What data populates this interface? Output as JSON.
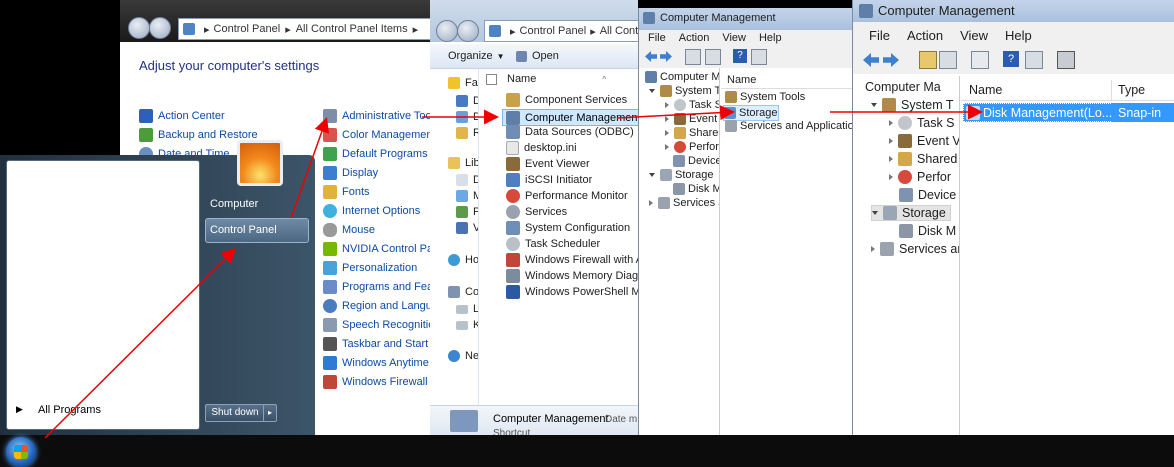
{
  "control_panel": {
    "breadcrumb": [
      "Control Panel",
      "All Control Panel Items"
    ],
    "heading": "Adjust your computer's settings",
    "left_items": [
      "Action Center",
      "Backup and Restore",
      "Date and Time"
    ],
    "items": [
      "Administrative Tools",
      "Color Management",
      "Default Programs",
      "Display",
      "Fonts",
      "Internet Options",
      "Mouse",
      "NVIDIA Control Panel",
      "Personalization",
      "Programs and Features",
      "Region and Language",
      "Speech Recognition",
      "Taskbar and Start Menu",
      "Windows Anytime Upgrade",
      "Windows Firewall"
    ]
  },
  "start_menu": {
    "right_items": [
      "Computer",
      "Control Panel"
    ],
    "all_programs": "All Programs",
    "shut_down": "Shut down"
  },
  "admin_tools": {
    "breadcrumb": [
      "Control Panel",
      "All Control Panel Items"
    ],
    "toolbar": {
      "organize": "Organize",
      "open": "Open"
    },
    "nav_items": [
      "Fav",
      "D",
      "D",
      "R",
      "Lib",
      "D",
      "M",
      "P",
      "V",
      "Ho",
      "Co",
      "L",
      "K",
      "Ne"
    ],
    "column_name": "Name",
    "files": [
      "Component Services",
      "Computer Management",
      "Data Sources (ODBC)",
      "desktop.ini",
      "Event Viewer",
      "iSCSI Initiator",
      "Performance Monitor",
      "Services",
      "System Configuration",
      "Task Scheduler",
      "Windows Firewall with Advanced Security",
      "Windows Memory Diagnostic",
      "Windows PowerShell Modules"
    ],
    "details_title": "Computer Management",
    "details_meta": "Date m",
    "details_type": "Shortcut"
  },
  "cm_small": {
    "title": "Computer Management",
    "menu": [
      "File",
      "Action",
      "View",
      "Help"
    ],
    "tree": [
      "Computer Ma",
      "System To",
      "Task S",
      "Event",
      "Shared",
      "Perfor",
      "Device",
      "Storage",
      "Disk M",
      "Services an"
    ],
    "column_name": "Name",
    "list": [
      "System Tools",
      "Storage",
      "Services and Applications"
    ]
  },
  "cm_large": {
    "title": "Computer Management",
    "menu": [
      "File",
      "Action",
      "View",
      "Help"
    ],
    "tree": [
      "Computer Ma",
      "System T",
      "Task S",
      "Event V",
      "Shared",
      "Perfor",
      "Device",
      "Storage",
      "Disk M",
      "Services ar"
    ],
    "columns": [
      "Name",
      "Type"
    ],
    "row": {
      "name": "Disk Management(Lo...",
      "type": "Snap-in"
    }
  },
  "colors": {
    "selection": "#3399ff",
    "arrow": "#ee0000",
    "link": "#0b4aa6",
    "taskbar": "#0c0c0c"
  }
}
